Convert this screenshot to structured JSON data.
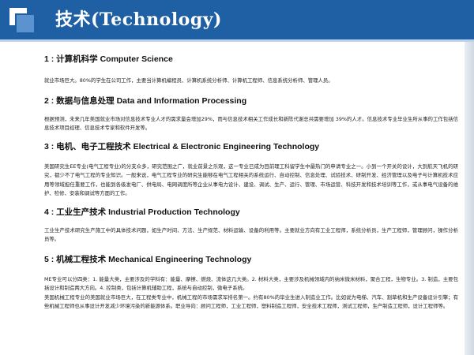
{
  "header": {
    "title": "技术(Technology)"
  },
  "colors": {
    "header_bg": "#1f5fa4",
    "accent_light": "#5a93d0"
  },
  "sections": [
    {
      "title": "1 : 计算机科学 Computer Science",
      "paragraphs": [
        "就业市场巨大。80%的学生在公司工作，主要当计算机编程员、计算机系统分析师、计算机工程师、信息系统分析师、管理人员。"
      ]
    },
    {
      "title": "2 : 数据与信息处理 Data and Information Processing",
      "paragraphs": [
        "根据预测，未来几年美国就业市场对信息技术专业人才的需求量会增加29%，而与信息技术相关工作成长和新陈代谢总共需要增加 39%的人才。信息技术专业毕业生所从事的工作包括信息技术项目经理、信息技术专家和软件开发等。"
      ]
    },
    {
      "title": "3 : 电机、电子工程技术 Electrical & Electronic Engineering Technology",
      "paragraphs": [
        "美国研究生EE专业(电气工程专业)的分支众多，研究范围之广，就业前景之乐观，这一专业已成为目前理工科留学生中最热门的申请专业之一。小到一个开关的设计，大到航天飞机的研究，都少不了电气工程的专业知识。一般来说，电气工程专业的研究生能够在电气工程相关的系统运行、自动控制、信息处理、试验技术、研制开发、经济管理以及电子与计算机技术应用等领域担任重要工作，也能到各级发电厂、供电局、电网调度所等企业从事电力设计、建设、调试、生产、运行、管理、市场运营、科技开发和技术培训等工作，或从事电气设备的维护、检修、安装和调试等方面的工作。"
      ]
    },
    {
      "title": "4 : 工业生产技术 Industrial Production Technology",
      "paragraphs": [
        "工业生产技术研究生产施工中的具体技术问题，如生产时间、方法、生产规范、材料运输、设备的利用等。主要就业方向有工业工程师，系统分析员，生产工程师，管理顾问，操作分析员等。"
      ]
    },
    {
      "title": "5 : 机械工程技术 Mechanical Engineering Technology",
      "paragraphs": [
        "ME专业可以分四类：1. 能量大类，主要涉及的学科有：能量、摩擦、燃烧、流体这几大类。2. 材料大类，主要涉及机械领域内的纳米微米材料，聚合工程，生物专业。3. 制造，主要包括设计和制造两大方向。4. 控制类，包括计算机辅助工程，系统与自动控制，微电子系统。",
        "美国机械工程专业的美国就业市场巨大，在工程类专业中，机械工程的市场需求军排名第一。约有80%的毕业生进入制造业工作。比如说为电梯、汽车、割草机和生产设备设计引擎；有些机械工程师也从事设计开发减少环境污染的新能源体系。职业导向：顾问工程师，工业工程师，塑料制造工程师，安全技术工程师，测试工程师，生产制造工程师，设计工程师等。"
      ]
    }
  ]
}
